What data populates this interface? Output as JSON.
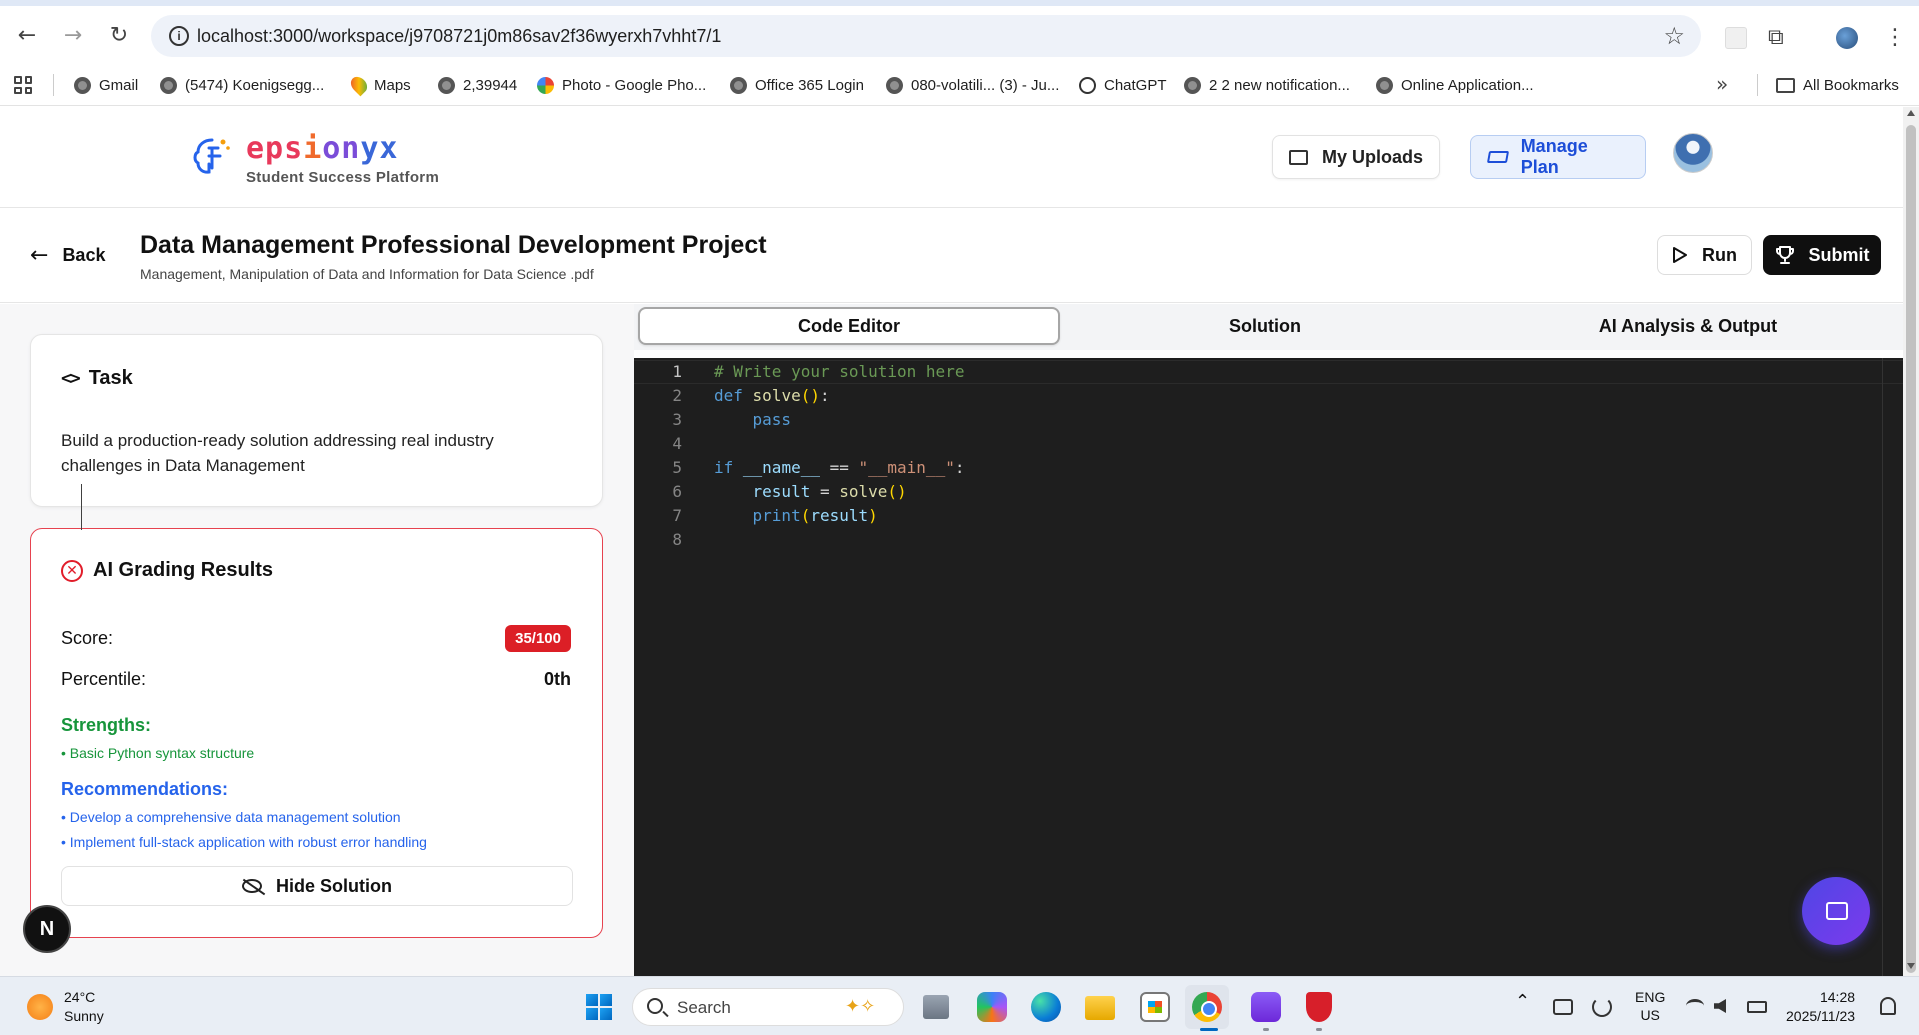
{
  "browser": {
    "url": "localhost:3000/workspace/j9708721j0m86sav2f36wyerxh7vhht7/1",
    "bookmarks": [
      {
        "label": "Gmail",
        "icon": "globe-icon"
      },
      {
        "label": "(5474) Koenigsegg...",
        "icon": "globe-icon"
      },
      {
        "label": "Maps",
        "icon": "maps-pin-icon"
      },
      {
        "label": "2,39944",
        "icon": "globe-icon"
      },
      {
        "label": "Photo - Google Pho...",
        "icon": "google-photos-icon"
      },
      {
        "label": "Office 365 Login",
        "icon": "globe-icon"
      },
      {
        "label": "080-volatili... (3) - Ju...",
        "icon": "globe-icon"
      },
      {
        "label": "ChatGPT",
        "icon": "chatgpt-icon"
      },
      {
        "label": "2 2 new notification...",
        "icon": "globe-icon"
      },
      {
        "label": "Online Application...",
        "icon": "globe-icon"
      }
    ],
    "all_bookmarks": "All Bookmarks"
  },
  "app": {
    "brand_name": [
      "eps",
      "i",
      "on",
      "yx"
    ],
    "brand_subtitle": "Student Success Platform",
    "my_uploads": "My Uploads",
    "manage_plan": "Manage Plan"
  },
  "project": {
    "back": "Back",
    "title": "Data Management Professional Development Project",
    "file": "Management, Manipulation of Data and Information for Data Science .pdf",
    "run": "Run",
    "submit": "Submit"
  },
  "task": {
    "heading": "Task",
    "body": "Build a production-ready solution addressing real industry challenges in Data Management"
  },
  "grading": {
    "heading": "AI Grading Results",
    "score_label": "Score:",
    "score_value": "35/100",
    "percentile_label": "Percentile:",
    "percentile_value": "0th",
    "strengths_title": "Strengths:",
    "strengths": [
      "• Basic Python syntax structure"
    ],
    "recommendations_title": "Recommendations:",
    "recommendations": [
      "• Develop a comprehensive data management solution",
      "• Implement full-stack application with robust error handling"
    ],
    "hide_solution": "Hide Solution"
  },
  "tabs": [
    "Code Editor",
    "Solution",
    "AI Analysis & Output"
  ],
  "editor": {
    "line_numbers": [
      "1",
      "2",
      "3",
      "4",
      "5",
      "6",
      "7",
      "8"
    ]
  },
  "taskbar": {
    "temperature": "24°C",
    "weather": "Sunny",
    "search": "Search",
    "lang_1": "ENG",
    "lang_2": "US",
    "time": "14:28",
    "date": "2025/11/23"
  },
  "colors": {
    "accent_blue": "#2563eb",
    "score_red": "#dc1f26",
    "strength_green": "#17953b",
    "editor_bg": "#1e1e1e"
  }
}
